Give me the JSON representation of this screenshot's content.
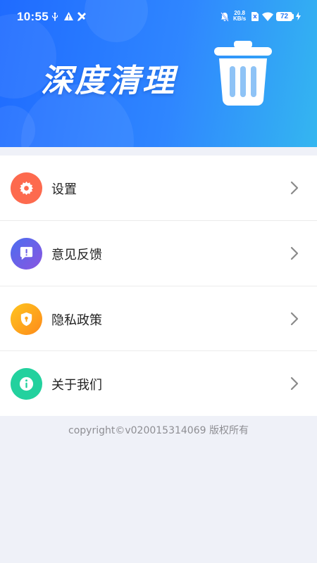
{
  "status_bar": {
    "time": "10:55",
    "net_speed_value": "20.8",
    "net_speed_unit": "KB/s",
    "battery": "72"
  },
  "banner": {
    "title": "深度清理"
  },
  "menu": {
    "items": [
      {
        "label": "设置",
        "icon": "gear-icon",
        "color": "#fd6a4e"
      },
      {
        "label": "意见反馈",
        "icon": "feedback-icon",
        "color": "#6b5fe6"
      },
      {
        "label": "隐私政策",
        "icon": "shield-icon",
        "color": "#fda51a"
      },
      {
        "label": "关于我们",
        "icon": "info-icon",
        "color": "#23d19e"
      }
    ]
  },
  "footer": {
    "copyright": "copyright©v020015314069 版权所有"
  }
}
